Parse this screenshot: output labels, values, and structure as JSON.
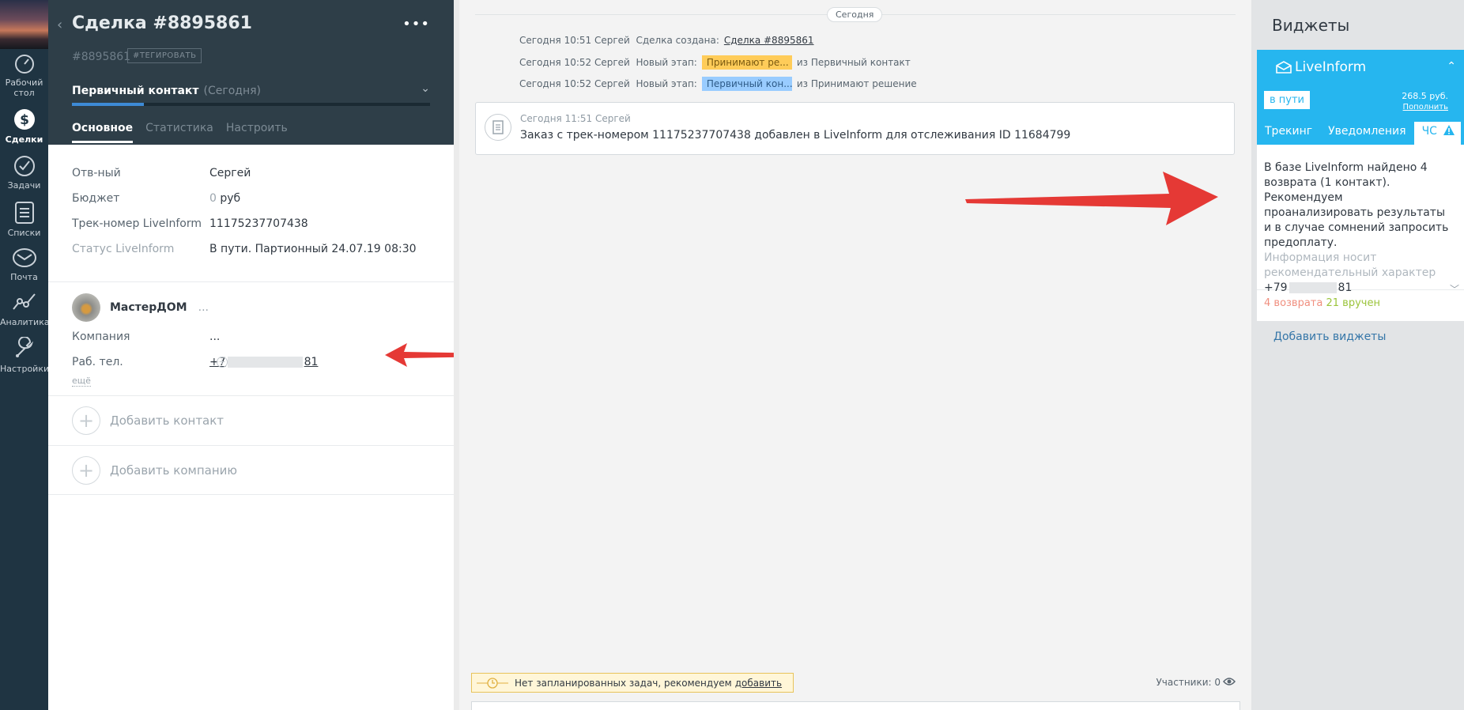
{
  "nav": {
    "items": [
      {
        "label": "Рабочий стол",
        "line1": "Рабочий",
        "line2": "стол"
      },
      {
        "label": "Сделки"
      },
      {
        "label": "Задачи"
      },
      {
        "label": "Списки"
      },
      {
        "label": "Почта"
      },
      {
        "label": "Аналитика"
      },
      {
        "label": "Настройки"
      }
    ]
  },
  "deal": {
    "title": "Сделка #8895861",
    "id": "#8895861",
    "tag_button": "#ТЕГИРОВАТЬ",
    "stage_name": "Первичный контакт",
    "stage_when": "(Сегодня)",
    "stage_progress_pct": 20,
    "tabs": [
      "Основное",
      "Статистика",
      "Настроить"
    ],
    "fields": [
      {
        "key": "Отв-ный",
        "value": "Сергей"
      },
      {
        "key": "Бюджет",
        "value_zero": "0",
        "value": "руб"
      },
      {
        "key": "Трек-номер LiveInform",
        "value": "11175237707438"
      },
      {
        "key": "Статус LiveInform",
        "value": "В пути. Партионный 24.07.19 08:30"
      }
    ],
    "contact": {
      "name": "МастерДОМ",
      "dots": "...",
      "company_label": "Компания",
      "company_value": "...",
      "phone_label": "Раб. тел.",
      "phone_prefix": "+7",
      "phone_suffix": "81",
      "more": "ещё"
    },
    "add_contact": "Добавить контакт",
    "add_company": "Добавить компанию"
  },
  "feed": {
    "day_label": "Сегодня",
    "events": [
      {
        "time": "Сегодня 10:51 Сергей",
        "text": "Сделка создана:",
        "link": "Сделка #8895861"
      },
      {
        "time": "Сегодня 10:52 Сергей",
        "text": "Новый этап:",
        "pill": "Принимают ре...",
        "tail": "из Первичный контакт"
      },
      {
        "time": "Сегодня 10:52 Сергей",
        "text": "Новый этап:",
        "pill": "Первичный кон...",
        "tail": "из Принимают решение"
      }
    ],
    "note": {
      "time": "Сегодня 11:51 Сергей",
      "text": "Заказ с трек-номером 11175237707438 добавлен в LiveInform для отслеживания ID 11684799"
    },
    "task_text": "Нет запланированных задач, рекомендуем",
    "task_link": "добавить",
    "members": "Участники: 0"
  },
  "widgets": {
    "title": "Виджеты",
    "brand": "LiveInform",
    "status": "в пути",
    "balance": "268.5 руб.",
    "topup": "Пополнить",
    "tabs": [
      "Трекинг",
      "Уведомления",
      "ЧС"
    ],
    "message": "В базе LiveInform найдено 4 возврата (1 контакт). Рекомендуем проанализировать результаты и в случае сомнений запросить предоплату.",
    "hint": "Информация носит рекомендательный характер",
    "phone_prefix": "+79",
    "phone_suffix": "81",
    "returns": "4 возврата",
    "delivered": "21 вручен",
    "add": "Добавить виджеты"
  },
  "colors": {
    "nav_bg": "#1f3442",
    "card_head_bg": "#2e3e48",
    "widget_accent": "#26b6ef",
    "stage_yellow": "#ffcc59",
    "stage_blue": "#99ccff",
    "arrow_red": "#e53935"
  },
  "icons": [
    "dashboard-icon",
    "deals-icon",
    "tasks-icon",
    "lists-icon",
    "mail-icon",
    "analytics-icon",
    "settings-icon",
    "note-icon",
    "clock-icon",
    "eye-icon",
    "warning-icon",
    "liveinform-logo-icon"
  ]
}
